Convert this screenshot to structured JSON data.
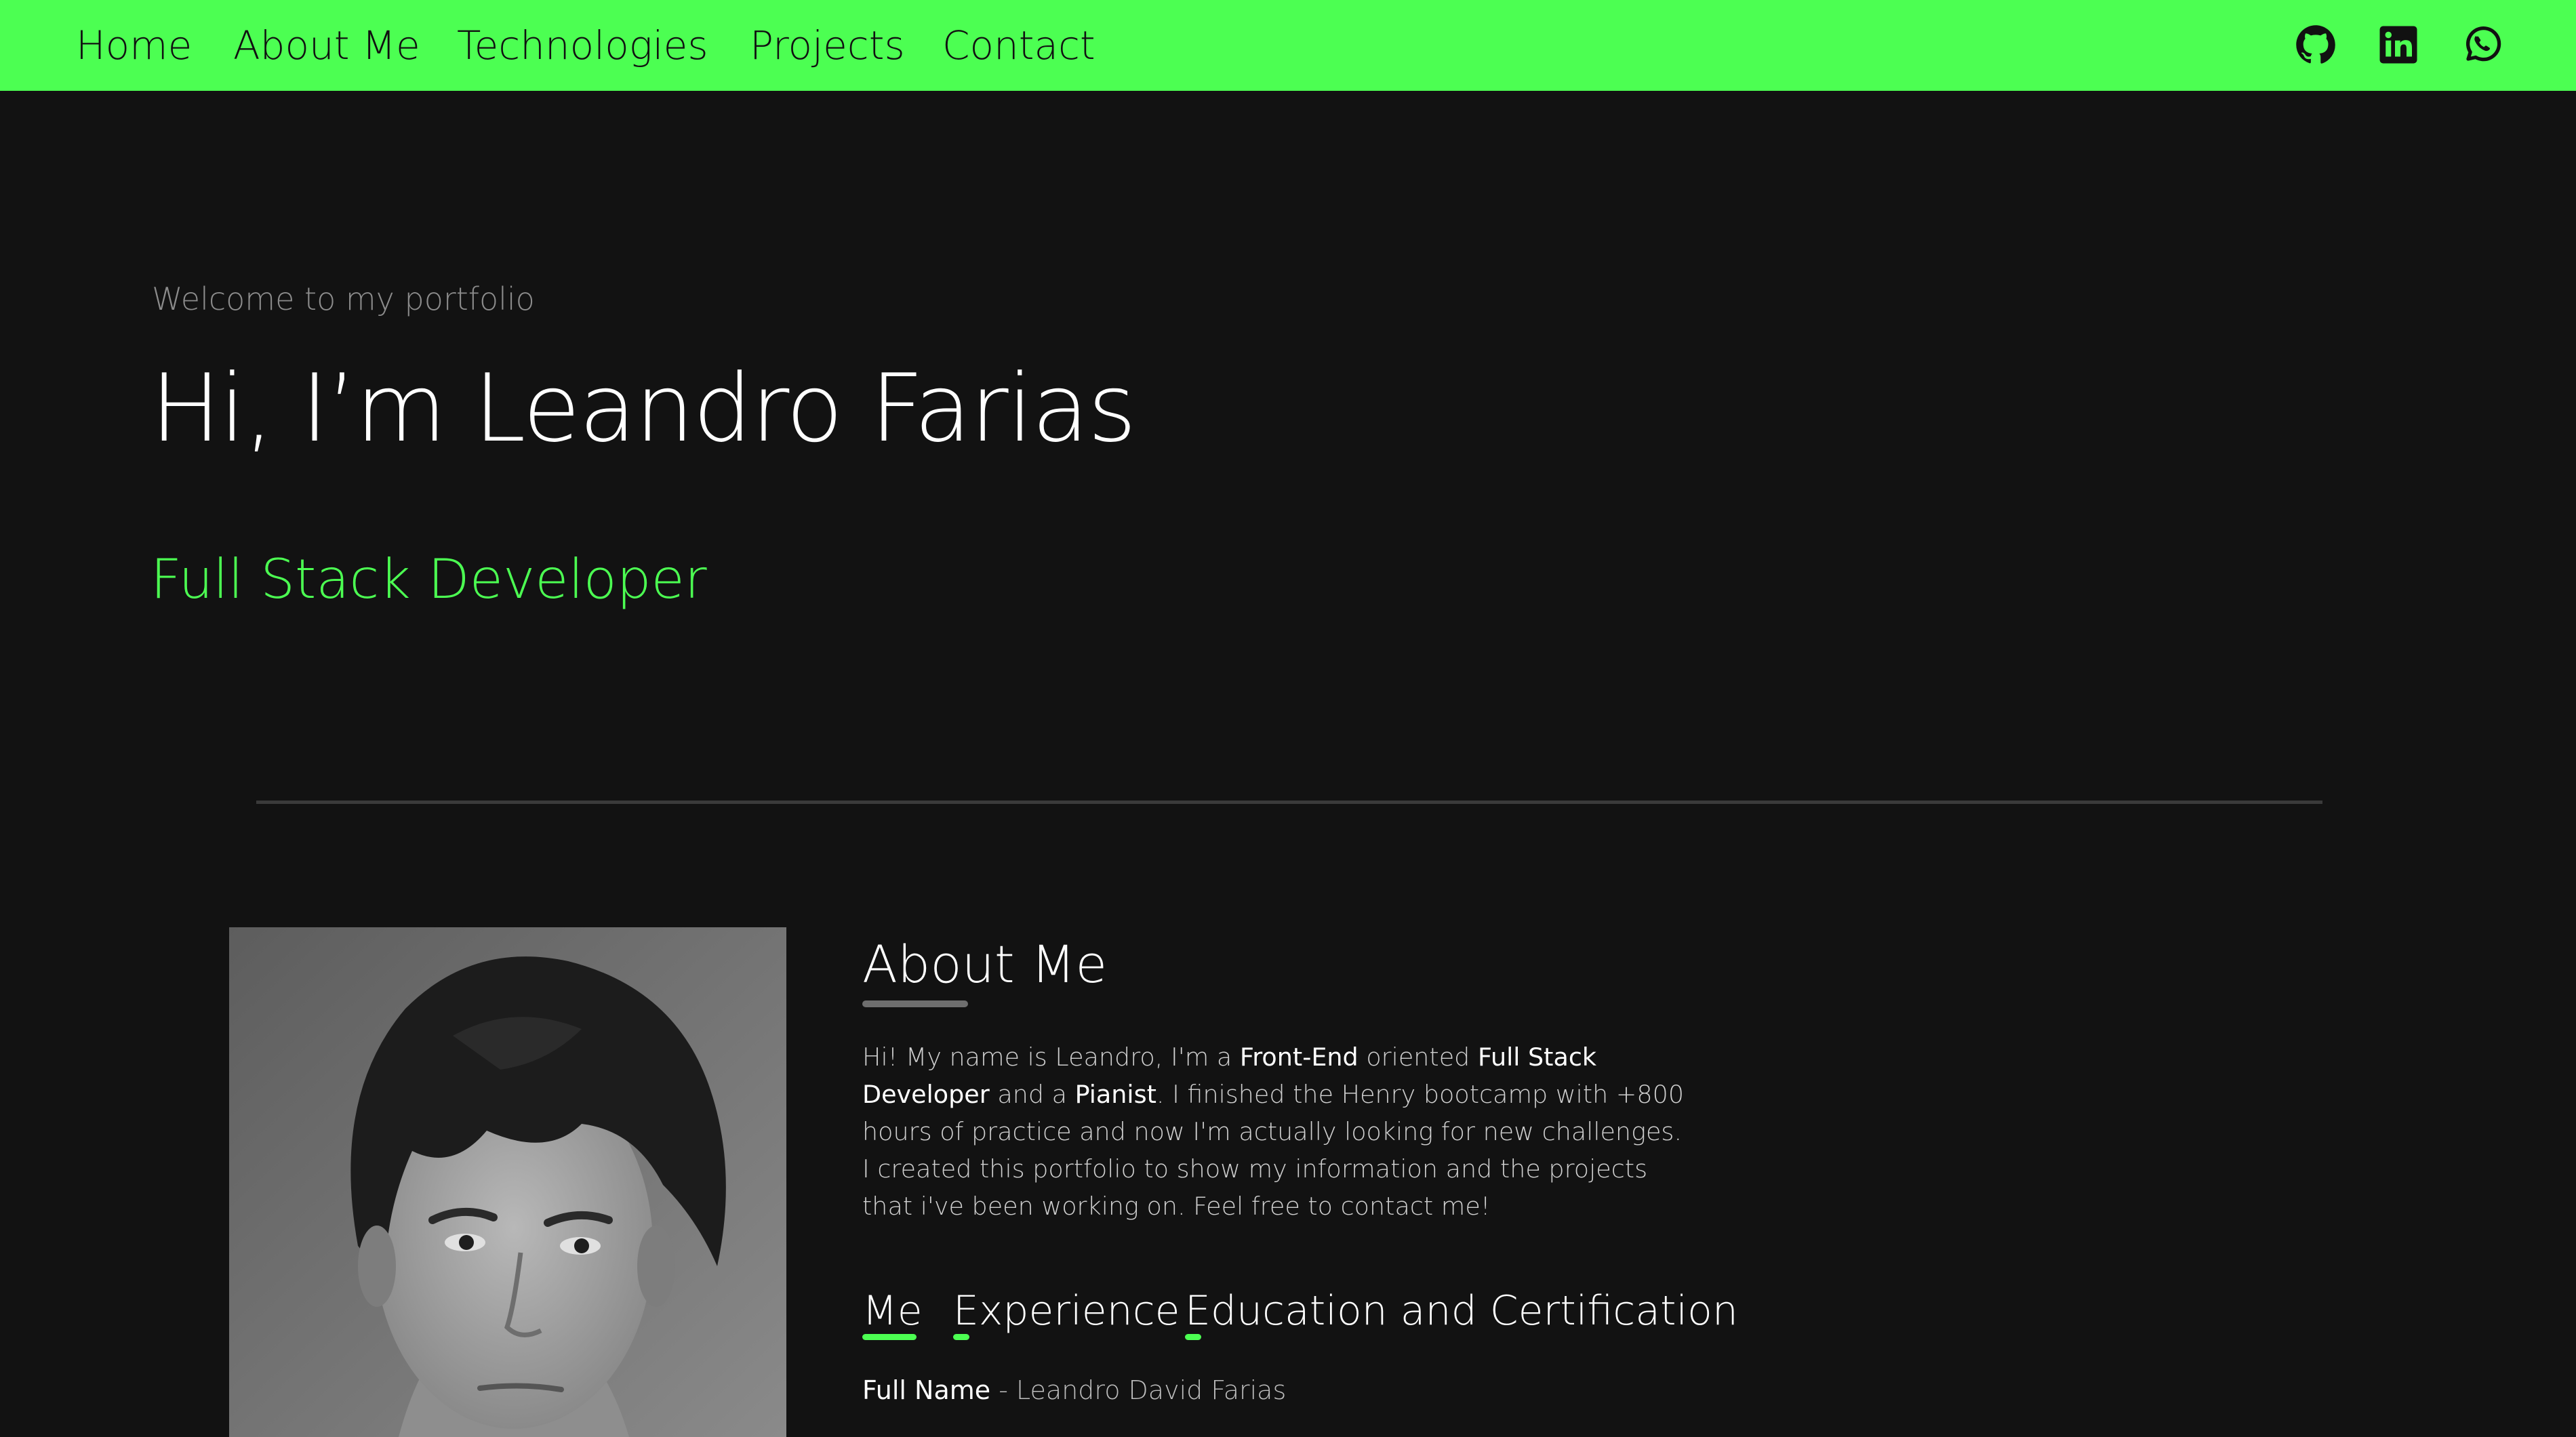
{
  "nav": {
    "links": [
      "Home",
      "About Me",
      "Technologies",
      "Projects",
      "Contact"
    ],
    "social_icons": [
      "github-icon",
      "linkedin-icon",
      "whatsapp-icon"
    ]
  },
  "colors": {
    "accent": "#4cff52",
    "background": "#121212",
    "text": "#ffffff",
    "muted": "#8c8c8c"
  },
  "hero": {
    "welcome": "Welcome to my portfolio",
    "title": "Hi, I’m Leandro Farias",
    "role": "Full Stack Developer"
  },
  "about": {
    "title": "About Me",
    "paragraph": {
      "p1": "Hi! My name is Leandro, I'm a ",
      "b1": "Front-End",
      "p2": " oriented ",
      "b2": "Full Stack Developer",
      "p3": " and a ",
      "b3": "Pianist",
      "p4": ". I finished the Henry bootcamp with +800 hours of practice and now I'm actually looking for new challenges. I created this portfolio to show my information and the projects that i've been working on. Feel free to contact me!"
    },
    "tabs": [
      "Me",
      "Experience",
      "Education and Certification"
    ],
    "details": {
      "fullname_label": "Full Name",
      "separator": " - ",
      "fullname_value": "Leandro David Farias"
    }
  }
}
